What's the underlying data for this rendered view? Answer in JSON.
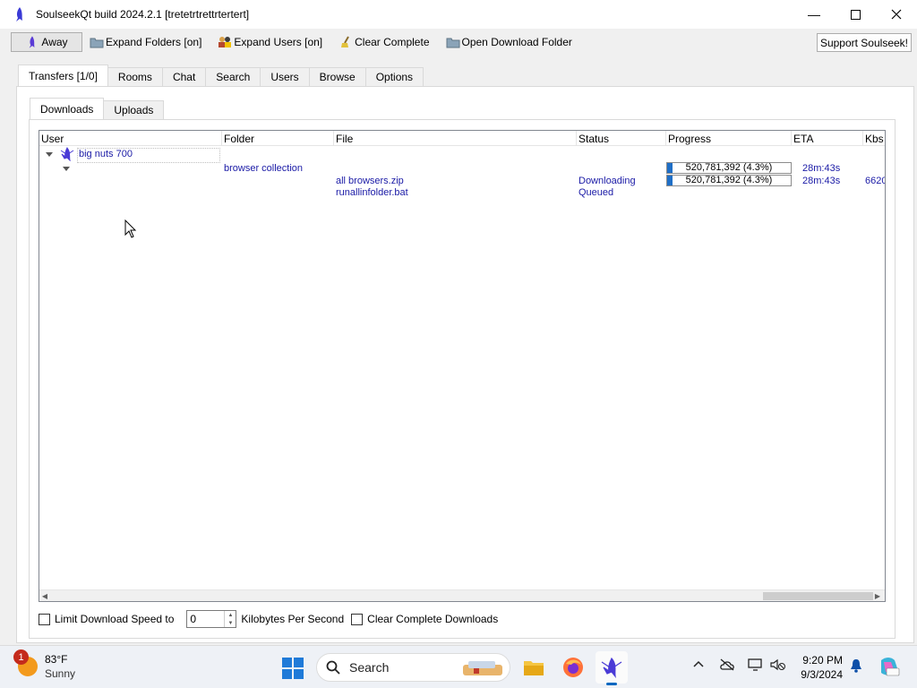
{
  "window": {
    "title": "SoulseekQt build 2024.2.1 [tretetrtrettrtertert]"
  },
  "toolbar": {
    "away_label": "Away",
    "expand_folders_label": "Expand Folders [on]",
    "expand_users_label": "Expand Users [on]",
    "clear_complete_label": "Clear Complete",
    "open_download_folder_label": "Open Download Folder",
    "support_label": "Support Soulseek!"
  },
  "main_tabs": [
    "Transfers [1/0]",
    "Rooms",
    "Chat",
    "Search",
    "Users",
    "Browse",
    "Options"
  ],
  "sub_tabs": [
    "Downloads",
    "Uploads"
  ],
  "table": {
    "columns": [
      "User",
      "Folder",
      "File",
      "Status",
      "Progress",
      "ETA",
      "Kbs"
    ],
    "user": "big nuts 700",
    "folder": "browser collection",
    "folder_progress": "520,781,392 (4.3%)",
    "folder_progress_fraction": 0.043,
    "folder_eta": "28m:43s",
    "files": [
      {
        "file": "all browsers.zip",
        "status": "Downloading",
        "progress": "520,781,392 (4.3%)",
        "progress_fraction": 0.043,
        "eta": "28m:43s",
        "kbs": "6620"
      },
      {
        "file": "runallinfolder.bat",
        "status": "Queued",
        "progress": "",
        "eta": "",
        "kbs": ""
      }
    ]
  },
  "bottom": {
    "limit_label": "Limit Download Speed to",
    "speed_value": "0",
    "unit_label": "Kilobytes Per Second",
    "clear_complete_label": "Clear Complete Downloads"
  },
  "taskbar": {
    "weather_badge": "1",
    "temperature": "83°F",
    "condition": "Sunny",
    "search_label": "Search",
    "time": "9:20 PM",
    "date": "9/3/2024"
  },
  "colors": {
    "accent": "#1f6fc7",
    "link_text": "#1a1aa6",
    "taskbar_accent": "#0067c0"
  }
}
